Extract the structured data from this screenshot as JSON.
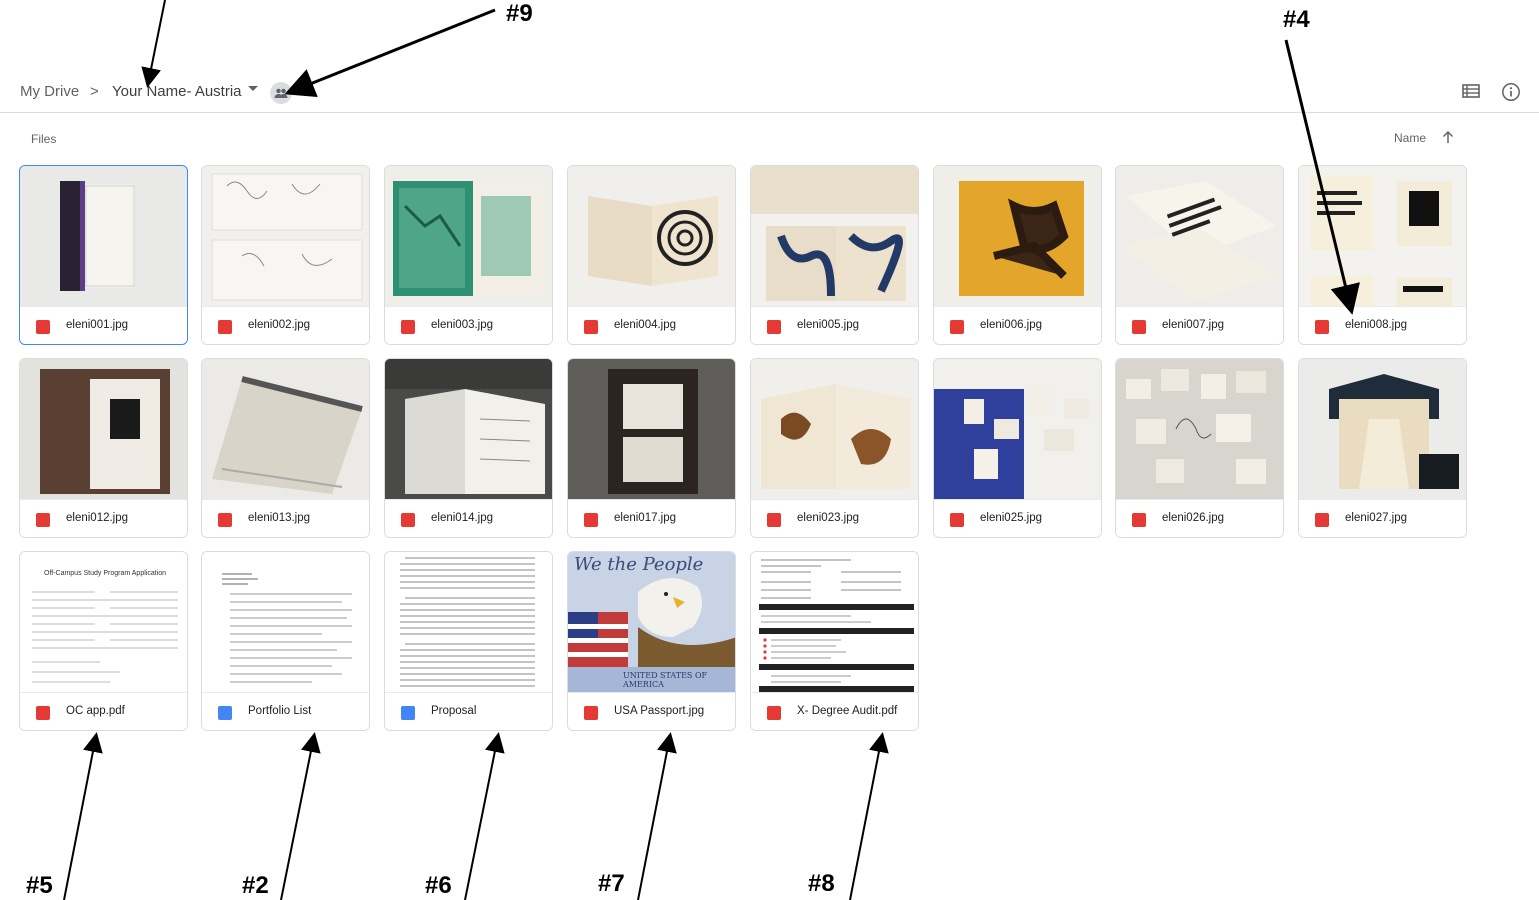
{
  "breadcrumb": {
    "root": "My Drive",
    "separator": ">",
    "current": "Your Name- Austria"
  },
  "toolbar": {
    "list_view_icon": "list-view-icon",
    "info_icon": "info-icon",
    "shared_icon": "shared-folder-icon"
  },
  "files_section": {
    "label": "Files",
    "sort_label": "Name",
    "sort_direction": "ascending"
  },
  "files": [
    {
      "name": "eleni001.jpg",
      "type": "image",
      "selected": true
    },
    {
      "name": "eleni002.jpg",
      "type": "image"
    },
    {
      "name": "eleni003.jpg",
      "type": "image"
    },
    {
      "name": "eleni004.jpg",
      "type": "image"
    },
    {
      "name": "eleni005.jpg",
      "type": "image"
    },
    {
      "name": "eleni006.jpg",
      "type": "image"
    },
    {
      "name": "eleni007.jpg",
      "type": "image"
    },
    {
      "name": "eleni008.jpg",
      "type": "image"
    },
    {
      "name": "eleni012.jpg",
      "type": "image"
    },
    {
      "name": "eleni013.jpg",
      "type": "image"
    },
    {
      "name": "eleni014.jpg",
      "type": "image"
    },
    {
      "name": "eleni017.jpg",
      "type": "image"
    },
    {
      "name": "eleni023.jpg",
      "type": "image"
    },
    {
      "name": "eleni025.jpg",
      "type": "image"
    },
    {
      "name": "eleni026.jpg",
      "type": "image"
    },
    {
      "name": "eleni027.jpg",
      "type": "image"
    },
    {
      "name": "OC app.pdf",
      "type": "pdf"
    },
    {
      "name": "Portfolio List",
      "type": "doc"
    },
    {
      "name": "Proposal",
      "type": "doc"
    },
    {
      "name": "USA Passport.jpg",
      "type": "image"
    },
    {
      "name": "X- Degree Audit.pdf",
      "type": "pdf"
    }
  ],
  "annotations": {
    "a9": "#9",
    "a4": "#4",
    "a5": "#5",
    "a2": "#2",
    "a6": "#6",
    "a7": "#7",
    "a8": "#8"
  },
  "thumbnail_text": {
    "oc_title": "Off-Campus Study Program Application",
    "passport_script": "We the People",
    "passport_banner": "UNITED STATES OF AMERICA"
  },
  "colors": {
    "accent_blue": "#4285f4",
    "image_red": "#e53935",
    "doc_blue": "#4285f4",
    "border": "#dadce0"
  }
}
